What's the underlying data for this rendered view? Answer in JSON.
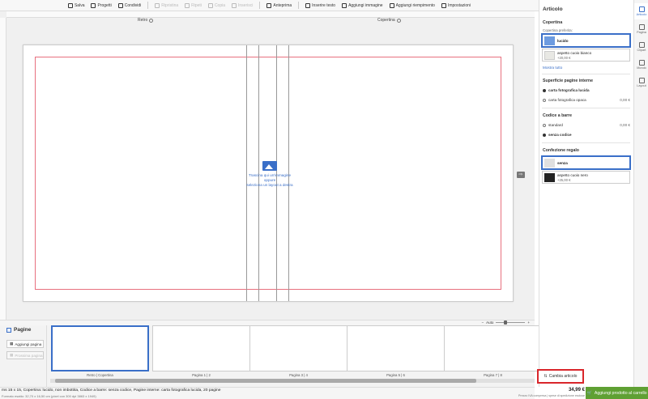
{
  "toolbar": {
    "items": [
      {
        "label": "Salva",
        "icon": "save-icon",
        "enabled": true
      },
      {
        "label": "Progetti",
        "icon": "folder-icon",
        "enabled": true
      },
      {
        "label": "Condividi",
        "icon": "share-icon",
        "enabled": true
      },
      {
        "label": "Ripristina",
        "icon": "undo-icon",
        "enabled": false
      },
      {
        "label": "Ripeti",
        "icon": "redo-icon",
        "enabled": false
      },
      {
        "label": "Copia",
        "icon": "copy-icon",
        "enabled": false
      },
      {
        "label": "Inserisci",
        "icon": "paste-icon",
        "enabled": false
      },
      {
        "label": "Anteprima",
        "icon": "preview-icon",
        "enabled": true
      },
      {
        "label": "Inserire testo",
        "icon": "text-icon",
        "enabled": true
      },
      {
        "label": "Aggiungi immagine",
        "icon": "image-icon",
        "enabled": true
      },
      {
        "label": "Aggiungi riempimento",
        "icon": "fill-icon",
        "enabled": true
      },
      {
        "label": "Impostazioni",
        "icon": "settings-icon",
        "enabled": true
      }
    ]
  },
  "canvas": {
    "back_label": "Retro",
    "front_label": "Copertina",
    "drop_line1": "Trascina qui un'immagine",
    "drop_line2": "oppure",
    "drop_line3": "seleziona un layout a destra"
  },
  "zoom": {
    "label": "Auto"
  },
  "pages_panel": {
    "title": "Pagine",
    "add_button": "Aggiungi pagina",
    "prev_button": "Prossima pagina"
  },
  "thumbnails": [
    {
      "label": "Retro | Copertina",
      "selected": true
    },
    {
      "label": "Pagina 1 | 2",
      "selected": false
    },
    {
      "label": "Pagina 3 | 4",
      "selected": false
    },
    {
      "label": "Pagina 5 | 6",
      "selected": false
    },
    {
      "label": "Pagina 7 | 8",
      "selected": false
    }
  ],
  "status": {
    "summary": "ms 15 x 15, Copertina: lucido, non imbottita, Codice a barre: senza codice, Pagine interne: carta fotografica lucida, 20 pagine",
    "detail": "Formato esatto: 32,70 x 16,50 cm (pixel con 300 dpi 3863 x 1949)",
    "price": "34,99 €",
    "price_note": "Prezzo IVA compresa | spese di spedizione escluse"
  },
  "panel": {
    "title": "Articolo",
    "cover_section": "Copertina",
    "cover_sub": "Copertina preferita:",
    "cover_options": [
      {
        "name": "lucido",
        "price": "",
        "selected": true,
        "color": "#6d9be0"
      },
      {
        "name": "aspetto cuoio bianco",
        "price": "+20,00 €",
        "selected": false,
        "color": "#e8e8e4"
      }
    ],
    "show_all": "Mostra tutto",
    "inner_section": "Superficie pagine interne",
    "inner_options": [
      {
        "name": "carta fotografica lucida",
        "price": "",
        "selected": true
      },
      {
        "name": "carta fotografica opaca",
        "price": "0,00 €",
        "selected": false
      }
    ],
    "barcode_section": "Codice a barre",
    "barcode_options": [
      {
        "name": "standard",
        "price": "0,00 €",
        "selected": false
      },
      {
        "name": "senza codice",
        "price": "",
        "selected": true
      }
    ],
    "gift_section": "Confezione regalo",
    "gift_options": [
      {
        "name": "senza",
        "price": "",
        "selected": true,
        "color": "#e0e0e0"
      },
      {
        "name": "aspetto cuoio nero",
        "price": "+25,00 €",
        "selected": false,
        "color": "#222222"
      }
    ],
    "change_button": "Cambia articolo",
    "cart_button": "Aggiungi prodotto al carrello"
  },
  "side_tabs": [
    {
      "label": "Articolo",
      "icon": "wrench-icon",
      "active": true
    },
    {
      "label": "Pagina",
      "icon": "page-icon",
      "active": false
    },
    {
      "label": "Clipart",
      "icon": "glasses-icon",
      "active": false
    },
    {
      "label": "Mondo",
      "icon": "world-icon",
      "active": false
    },
    {
      "label": "Layout",
      "icon": "pencil-icon",
      "active": false
    }
  ],
  "colors": {
    "accent": "#3a6fc8",
    "cart": "#5fa033",
    "highlight": "#d9262b",
    "bleed": "#e8707f"
  }
}
